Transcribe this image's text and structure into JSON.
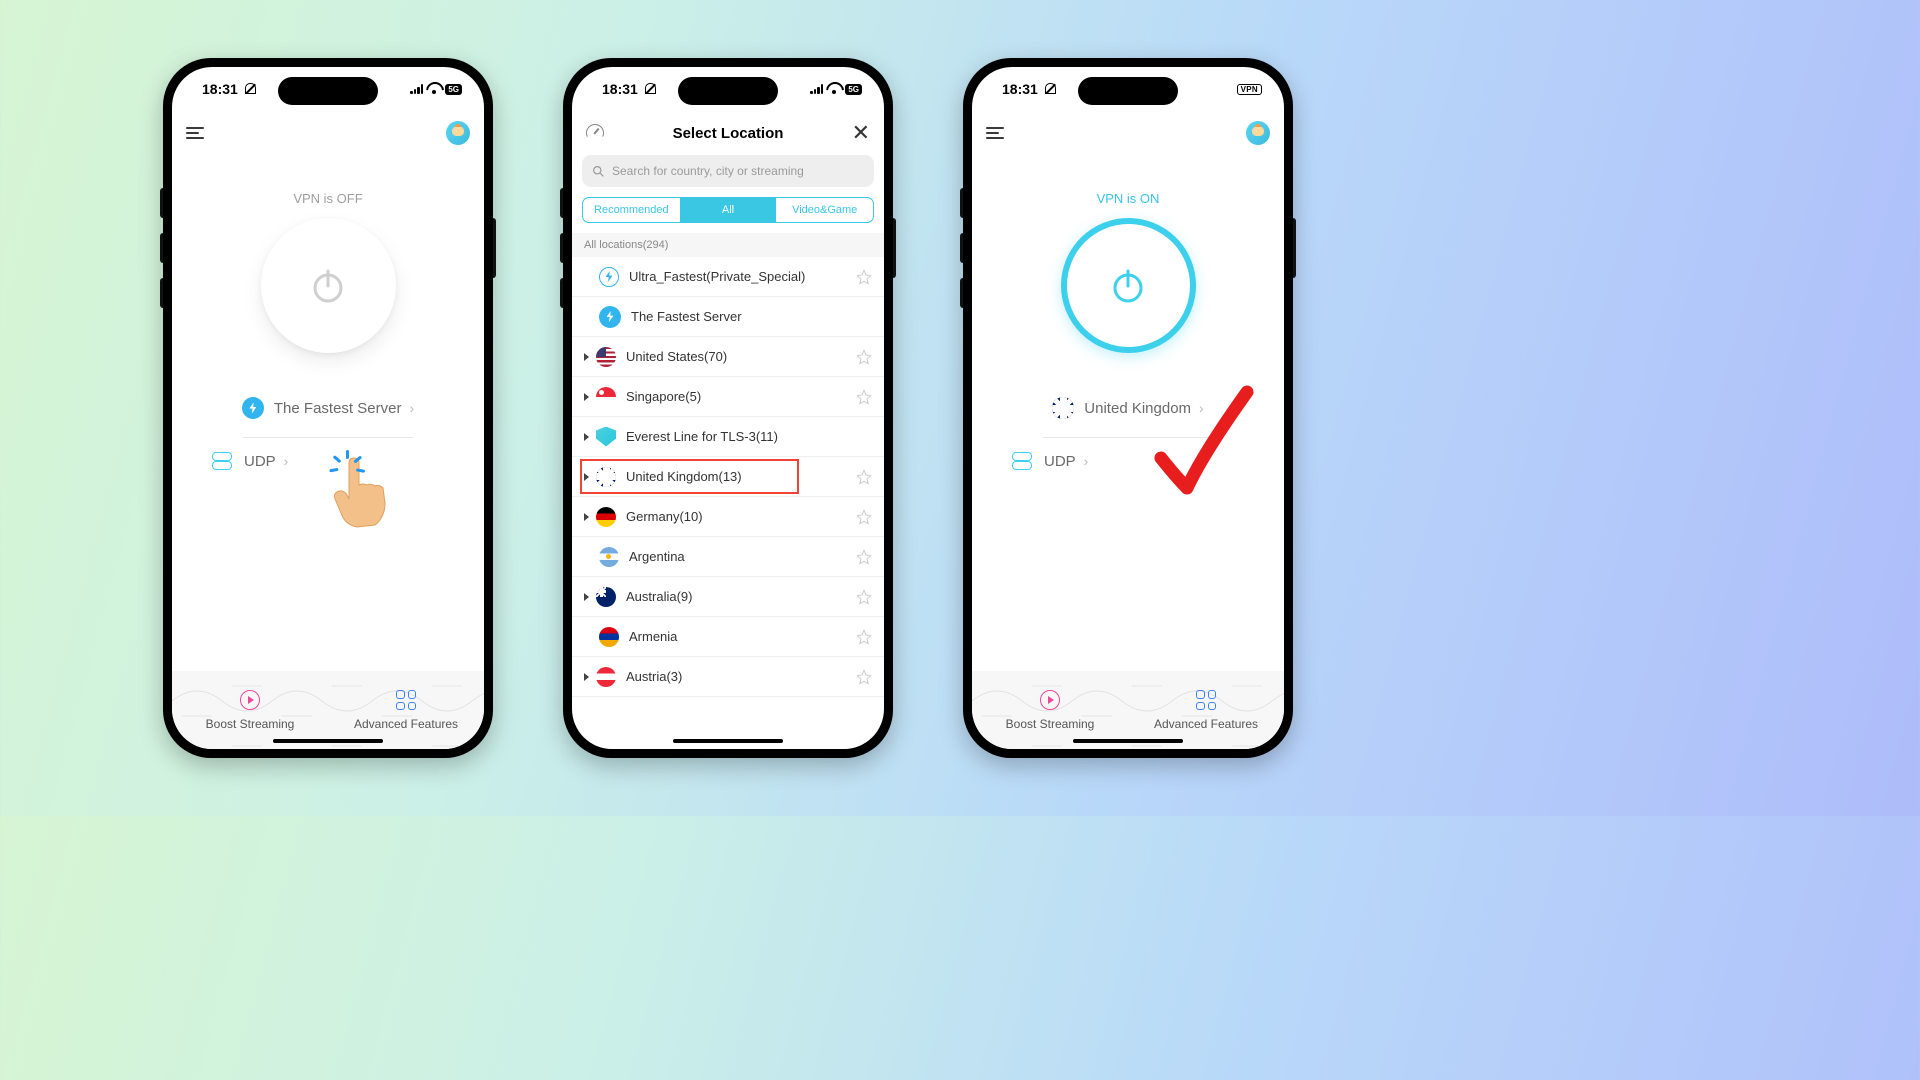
{
  "status": {
    "time": "18:31",
    "badge_5g": "5G",
    "vpn_badge": "VPN"
  },
  "screen1": {
    "vpn_status": "VPN is OFF",
    "server": "The Fastest Server",
    "protocol": "UDP",
    "bottom": {
      "boost": "Boost Streaming",
      "advanced": "Advanced Features"
    }
  },
  "screen2": {
    "title": "Select Location",
    "search_placeholder": "Search for country, city or streaming",
    "tabs": {
      "rec": "Recommended",
      "all": "All",
      "vid": "Video&Game"
    },
    "section_header": "All locations(294)",
    "locations": [
      {
        "name": "Ultra_Fastest(Private_Special)",
        "flag": "bolt-outline",
        "expandable": false,
        "star": true
      },
      {
        "name": "The Fastest Server",
        "flag": "bolt-fill",
        "expandable": false,
        "star": false
      },
      {
        "name": "United States(70)",
        "flag": "flag-us",
        "expandable": true,
        "star": true
      },
      {
        "name": "Singapore(5)",
        "flag": "flag-sg",
        "expandable": true,
        "star": true
      },
      {
        "name": "Everest Line for TLS-3(11)",
        "flag": "flag-shield",
        "expandable": true,
        "star": false
      },
      {
        "name": "United Kingdom(13)",
        "flag": "flag-uk-sm",
        "expandable": true,
        "star": true,
        "highlighted": true
      },
      {
        "name": "Germany(10)",
        "flag": "flag-de",
        "expandable": true,
        "star": true
      },
      {
        "name": "Argentina",
        "flag": "flag-ar",
        "expandable": false,
        "star": true
      },
      {
        "name": "Australia(9)",
        "flag": "flag-au",
        "expandable": true,
        "star": true
      },
      {
        "name": "Armenia",
        "flag": "flag-am",
        "expandable": false,
        "star": true
      },
      {
        "name": "Austria(3)",
        "flag": "flag-at",
        "expandable": true,
        "star": true
      }
    ]
  },
  "screen3": {
    "vpn_status": "VPN is ON",
    "server": "United Kingdom",
    "protocol": "UDP",
    "bottom": {
      "boost": "Boost Streaming",
      "advanced": "Advanced Features"
    }
  }
}
